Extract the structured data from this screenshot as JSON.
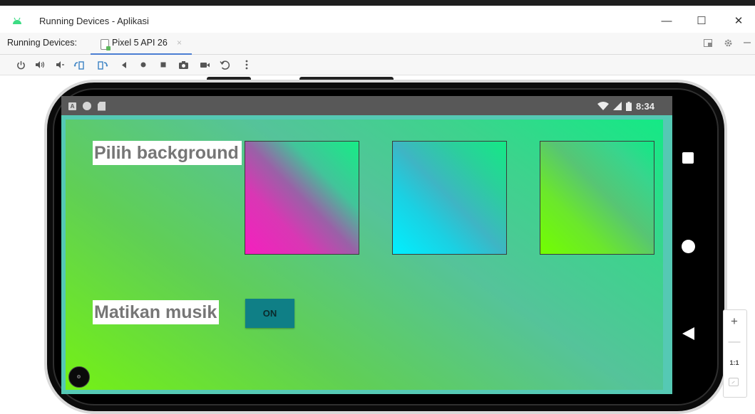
{
  "window": {
    "title": "Running Devices - Aplikasi",
    "buttons": {
      "minimize": "—",
      "maximize": "☐",
      "close": "✕"
    }
  },
  "tabs": {
    "prefix": "Running Devices:",
    "items": [
      {
        "label": "Pixel 5 API 26",
        "close": "×"
      }
    ]
  },
  "toolbar": {
    "icons": [
      "power-icon",
      "volume-up-icon",
      "volume-down-icon",
      "rotate-left-icon",
      "rotate-right-icon",
      "back-icon",
      "home-icon",
      "overview-icon",
      "screenshot-icon",
      "screen-record-icon",
      "reset-icon",
      "more-options-icon"
    ]
  },
  "device": {
    "status_bar": {
      "time": "8:34",
      "left_badge": "A"
    },
    "app": {
      "pick_background_label": "Pilih background",
      "mute_music_label": "Matikan musik",
      "toggle_label": "ON",
      "swatches": [
        {
          "name": "pink-green",
          "colors": [
            "#f51fbf",
            "#14e985"
          ]
        },
        {
          "name": "cyan-green",
          "colors": [
            "#00f0ff",
            "#14e985"
          ]
        },
        {
          "name": "lime-green",
          "colors": [
            "#72ff00",
            "#12e985"
          ]
        }
      ]
    }
  },
  "zoom": {
    "in": "+",
    "out": "—",
    "actual_size": "1:1"
  },
  "colors": {
    "accent_tab": "#4a7ed3",
    "toggle_bg": "#0f7f86",
    "status_bar": "#585858"
  }
}
